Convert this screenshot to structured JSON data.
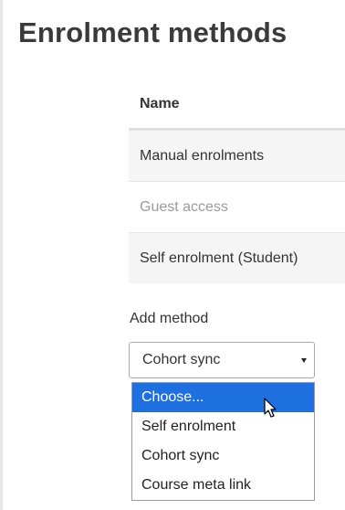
{
  "page": {
    "title": "Enrolment methods"
  },
  "table": {
    "header_name": "Name",
    "rows": [
      {
        "name": "Manual enrolments",
        "enabled": true
      },
      {
        "name": "Guest access",
        "enabled": false
      },
      {
        "name": "Self enrolment (Student)",
        "enabled": true
      }
    ]
  },
  "add_method": {
    "label": "Add method",
    "selected_value": "Cohort sync",
    "options": [
      "Choose...",
      "Self enrolment",
      "Cohort sync",
      "Course meta link"
    ],
    "highlighted_option": "Choose..."
  },
  "colors": {
    "highlight": "#1e6fe0",
    "row_stripe": "#f5f5f5",
    "disabled_text": "#9a9a9a"
  },
  "icons": {
    "dropdown_arrow": "caret-down-icon",
    "pointer": "mouse-cursor-icon"
  }
}
